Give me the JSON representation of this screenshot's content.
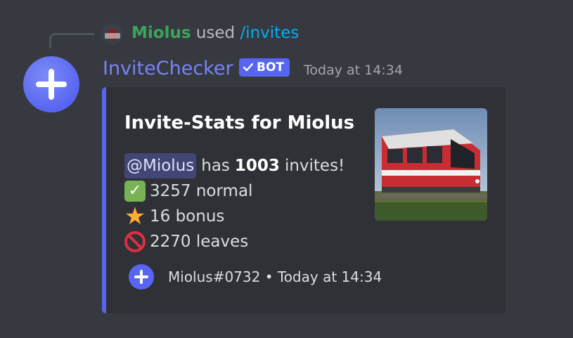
{
  "reply": {
    "username": "Miolus",
    "used": "used",
    "command": "/invites"
  },
  "message": {
    "username": "InviteChecker",
    "bot_tag": "BOT",
    "timestamp": "Today at 14:34"
  },
  "embed": {
    "accent_color": "#5865f2",
    "title": "Invite-Stats for Miolus",
    "mention": "@Miolus",
    "has": "has",
    "invite_count": "1003",
    "invites_suffix": "invites!",
    "stats": [
      {
        "icon": "check-mark-icon",
        "text": "3257 normal"
      },
      {
        "icon": "star-icon",
        "text": "16 bonus"
      },
      {
        "icon": "no-entry-icon",
        "text": "2270 leaves"
      }
    ],
    "footer": {
      "text": "Miolus#0732",
      "separator": "•",
      "timestamp": "Today at 14:34"
    },
    "thumbnail": "train-photo"
  }
}
